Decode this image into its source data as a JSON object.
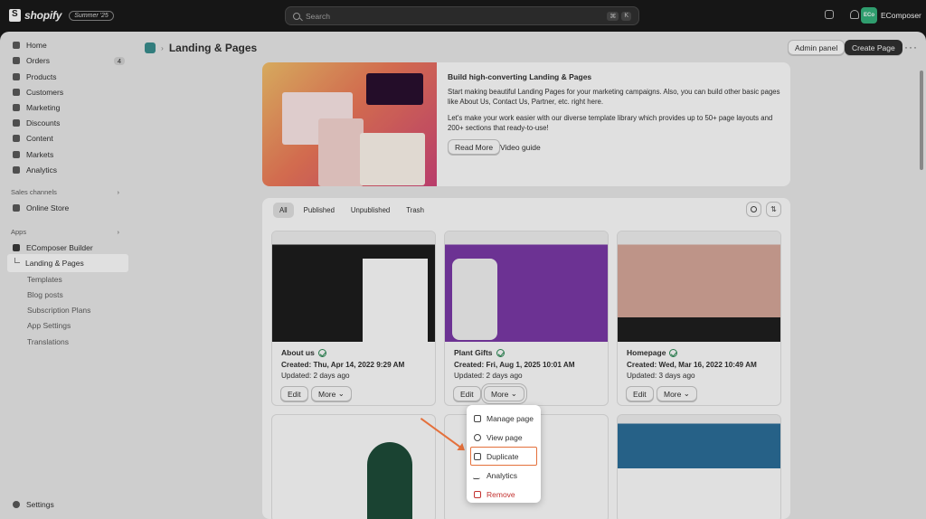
{
  "topbar": {
    "brand": "shopify",
    "badge": "Summer '25",
    "search_placeholder": "Search",
    "shortcut_keys": [
      "⌘",
      "K"
    ],
    "store_avatar": "ECo",
    "store_name": "EComposer"
  },
  "sidebar": {
    "items": [
      {
        "label": "Home",
        "icon": "home-icon"
      },
      {
        "label": "Orders",
        "icon": "orders-icon",
        "count": "4"
      },
      {
        "label": "Products",
        "icon": "tag-icon"
      },
      {
        "label": "Customers",
        "icon": "person-icon"
      },
      {
        "label": "Marketing",
        "icon": "target-icon"
      },
      {
        "label": "Discounts",
        "icon": "discount-icon"
      },
      {
        "label": "Content",
        "icon": "content-icon"
      },
      {
        "label": "Markets",
        "icon": "globe-icon"
      },
      {
        "label": "Analytics",
        "icon": "chart-icon"
      }
    ],
    "sales_channels_label": "Sales channels",
    "online_store": "Online Store",
    "apps_label": "Apps",
    "app_name": "EComposer Builder",
    "app_sub_items": [
      "Landing & Pages",
      "Templates",
      "Blog posts",
      "Subscription Plans",
      "App Settings",
      "Translations"
    ],
    "settings": "Settings"
  },
  "header": {
    "title": "Landing & Pages",
    "admin_panel": "Admin panel",
    "create_page": "Create Page"
  },
  "banner": {
    "title": "Build high-converting Landing & Pages",
    "desc1": "Start making beautiful Landing Pages for your marketing campaigns. Also, you can build other basic pages like About Us, Contact Us, Partner, etc. right here.",
    "desc2": "Let's make your work easier with our diverse template library which provides up to 50+ page layouts and 200+ sections that ready-to-use!",
    "read_more": "Read More",
    "video_guide": "Video guide"
  },
  "tabs": [
    "All",
    "Published",
    "Unpublished",
    "Trash"
  ],
  "pages": [
    {
      "title": "About us",
      "created": "Created: Thu, Apr 14, 2022 9:29 AM",
      "updated": "Updated: 2 days ago"
    },
    {
      "title": "Plant Gifts",
      "created": "Created: Fri, Aug 1, 2025 10:01 AM",
      "updated": "Updated: 2 days ago"
    },
    {
      "title": "Homepage",
      "created": "Created: Wed, Mar 16, 2022 10:49 AM",
      "updated": "Updated: 3 days ago"
    }
  ],
  "card_actions": {
    "edit": "Edit",
    "more": "More"
  },
  "more_menu": [
    {
      "label": "Manage page",
      "icon": "page-icon"
    },
    {
      "label": "View page",
      "icon": "eye-icon"
    },
    {
      "label": "Duplicate",
      "icon": "duplicate-icon"
    },
    {
      "label": "Analytics",
      "icon": "analytics-icon"
    },
    {
      "label": "Remove",
      "icon": "trash-icon"
    }
  ],
  "colors": {
    "accent": "#303030",
    "highlight": "#e4703b",
    "danger": "#c3312f",
    "success": "#2e8b57"
  }
}
